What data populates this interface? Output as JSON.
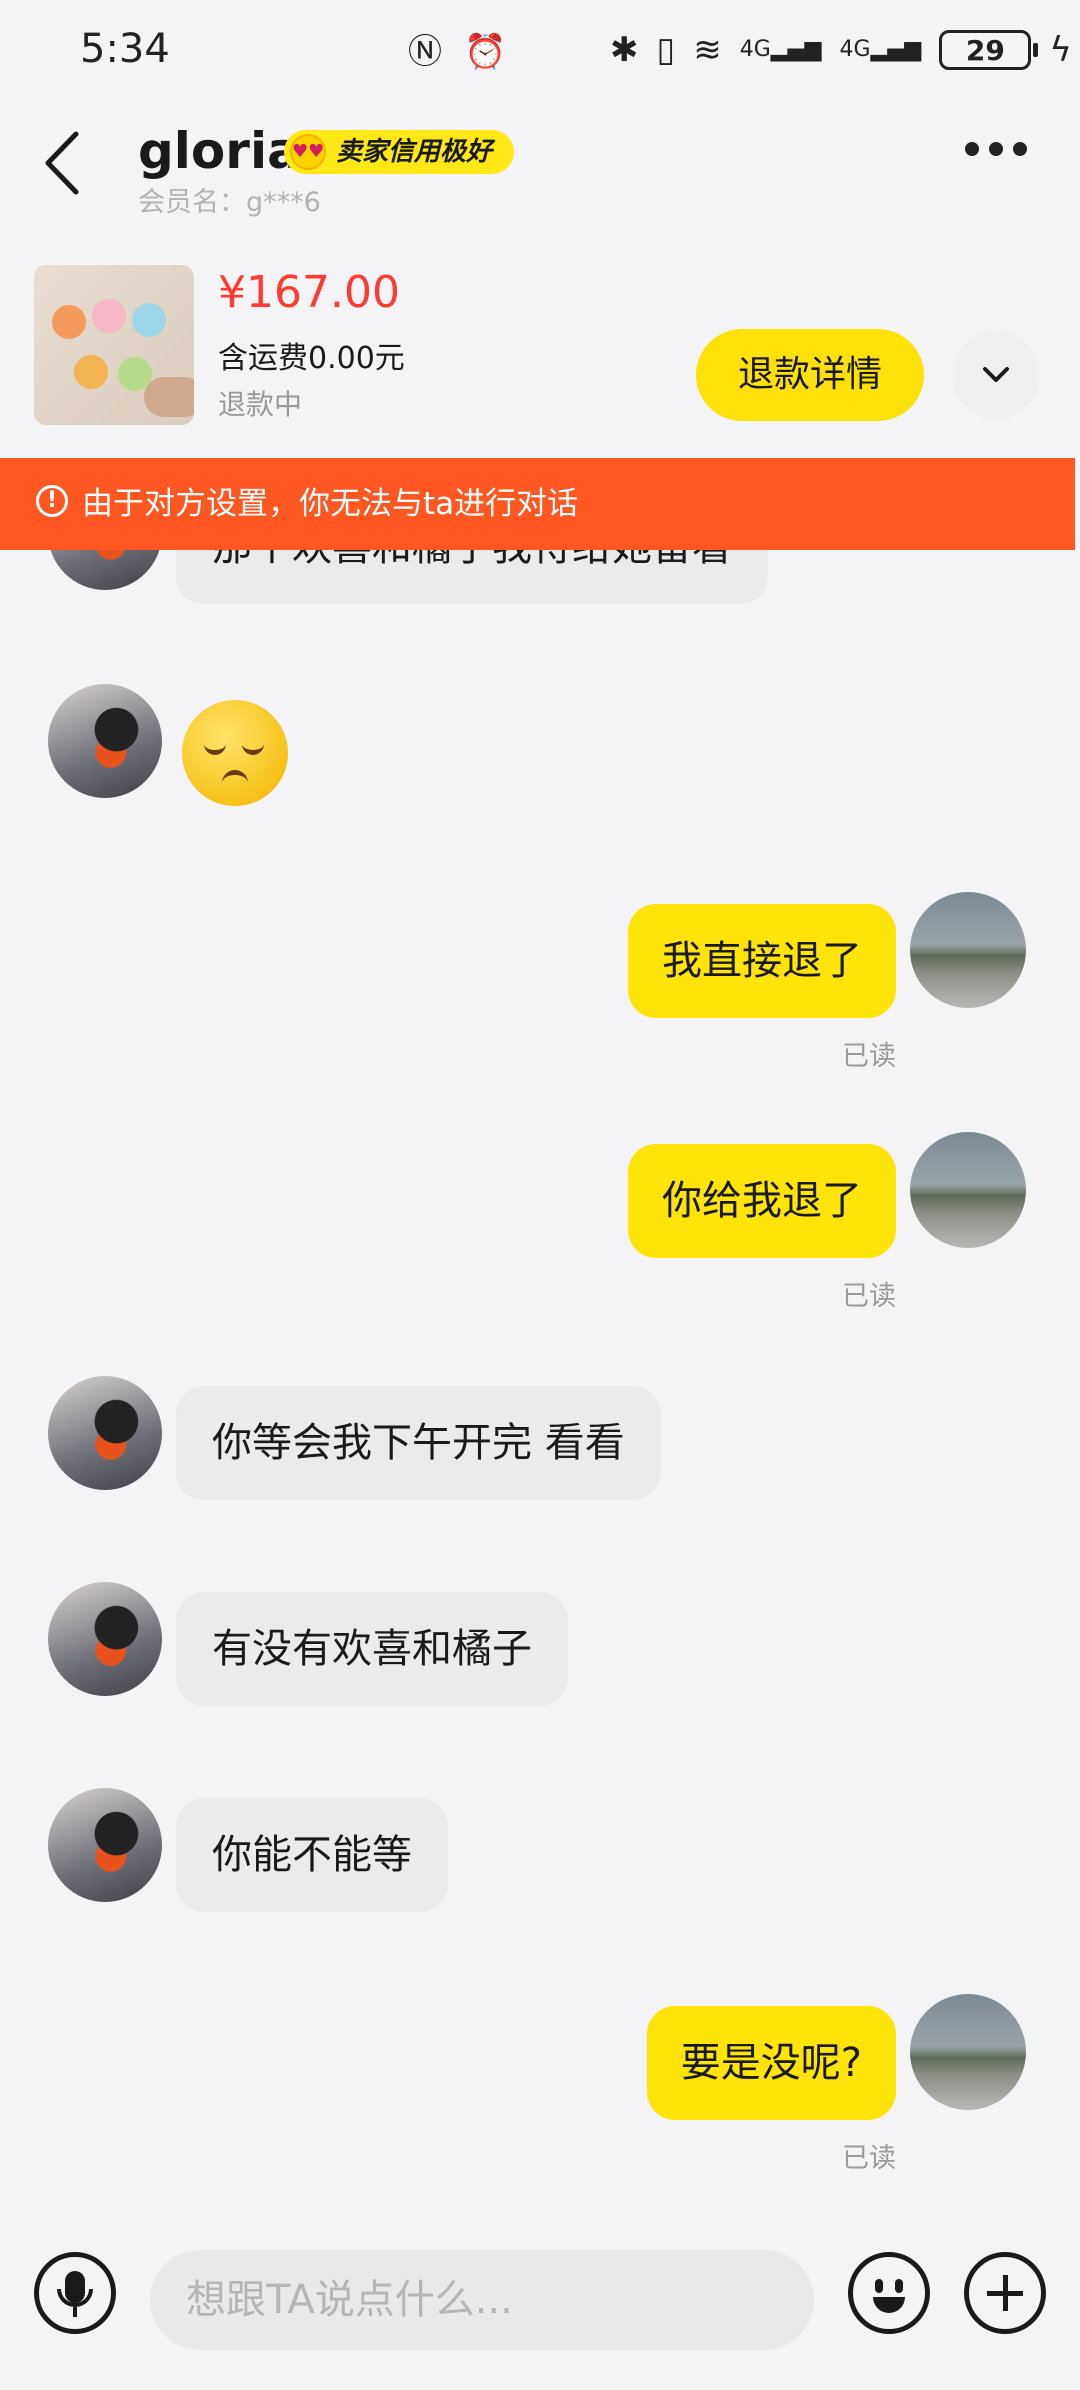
{
  "status_bar": {
    "time": "5:34",
    "battery": "29",
    "network": [
      "4G",
      "4G"
    ]
  },
  "header": {
    "nickname": "gloria",
    "badge": "卖家信用极好",
    "member_label": "会员名：g***6"
  },
  "product": {
    "price": "¥167.00",
    "shipping": "含运费0.00元",
    "status": "退款中",
    "refund_button": "退款详情"
  },
  "warning": {
    "text": "由于对方设置，你无法与ta进行对话"
  },
  "messages": [
    {
      "side": "left",
      "text": "那个欢喜和橘子我待给她留看"
    },
    {
      "side": "left",
      "text": "",
      "sticker": "sleepy-face-emoji"
    },
    {
      "side": "right",
      "text": "我直接退了",
      "read": "已读"
    },
    {
      "side": "right",
      "text": "你给我退了",
      "read": "已读"
    },
    {
      "side": "left",
      "text": "你等会我下午开完 看看"
    },
    {
      "side": "left",
      "text": "有没有欢喜和橘子"
    },
    {
      "side": "left",
      "text": "你能不能等"
    },
    {
      "side": "right",
      "text": "要是没呢?",
      "read": "已读"
    }
  ],
  "input": {
    "placeholder": "想跟TA说点什么..."
  },
  "colors": {
    "accent_yellow": "#ffe40a",
    "warning_orange": "#ff5722",
    "price_red": "#ff3b30"
  }
}
